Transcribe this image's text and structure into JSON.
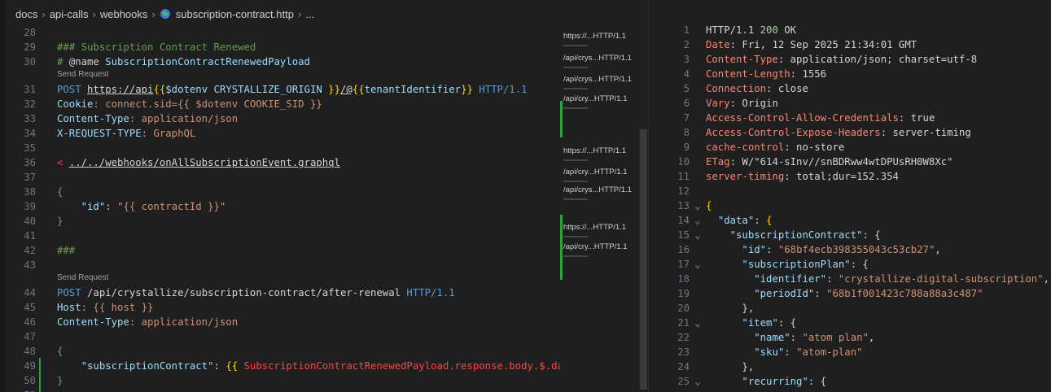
{
  "breadcrumb": [
    "docs",
    "api-calls",
    "webhooks",
    "subscription-contract.http",
    "..."
  ],
  "code_lens": [
    "Send Request",
    "Send Request"
  ],
  "editor_lines": [
    {
      "n": "28",
      "segs": []
    },
    {
      "n": "29",
      "segs": [
        {
          "t": "### Subscription Contract Renewed",
          "c": "c-comment"
        }
      ]
    },
    {
      "n": "30",
      "segs": [
        {
          "t": "# ",
          "c": "c-comment"
        },
        {
          "t": "@name ",
          "c": "c-plain"
        },
        {
          "t": "SubscriptionContractRenewedPayload",
          "c": "c-var"
        }
      ]
    },
    {
      "n": "31",
      "segs": [
        {
          "t": "POST ",
          "c": "c-method"
        },
        {
          "t": "https://api",
          "c": "c-url"
        },
        {
          "t": "{{",
          "c": "c-brace"
        },
        {
          "t": "$dotenv CRYSTALLIZE_ORIGIN ",
          "c": "c-var"
        },
        {
          "t": "}}",
          "c": "c-brace"
        },
        {
          "t": "/@",
          "c": "c-url"
        },
        {
          "t": "{{",
          "c": "c-brace"
        },
        {
          "t": "tenantIdentifier",
          "c": "c-var"
        },
        {
          "t": "}}",
          "c": "c-brace"
        },
        {
          "t": " HTTP/1.1",
          "c": "c-method"
        }
      ]
    },
    {
      "n": "32",
      "segs": [
        {
          "t": "Cookie",
          "c": "c-var"
        },
        {
          "t": ": connect.sid={{ $dotenv COOKIE_SID }}",
          "c": "c-str"
        }
      ]
    },
    {
      "n": "33",
      "segs": [
        {
          "t": "Content-Type",
          "c": "c-var"
        },
        {
          "t": ": application/json",
          "c": "c-str"
        }
      ]
    },
    {
      "n": "34",
      "segs": [
        {
          "t": "X-REQUEST-TYPE",
          "c": "c-var"
        },
        {
          "t": ": GraphQL",
          "c": "c-str"
        }
      ]
    },
    {
      "n": "35",
      "segs": []
    },
    {
      "n": "36",
      "segs": [
        {
          "t": "< ",
          "c": "c-red"
        },
        {
          "t": "../../webhooks/onAllSubscriptionEvent.graphql",
          "c": "c-url"
        }
      ]
    },
    {
      "n": "37",
      "segs": []
    },
    {
      "n": "38",
      "segs": [
        {
          "t": "{",
          "c": "c-method"
        }
      ]
    },
    {
      "n": "39",
      "segs": [
        {
          "t": "    ",
          "c": "c-plain"
        },
        {
          "t": "\"id\"",
          "c": "c-var"
        },
        {
          "t": ": ",
          "c": "c-plain"
        },
        {
          "t": "\"{{ contractId }}\"",
          "c": "c-str"
        }
      ]
    },
    {
      "n": "40",
      "segs": [
        {
          "t": "}",
          "c": "c-method"
        }
      ]
    },
    {
      "n": "41",
      "segs": []
    },
    {
      "n": "42",
      "segs": [
        {
          "t": "###",
          "c": "c-comment"
        }
      ]
    },
    {
      "n": "43",
      "segs": []
    },
    {
      "n": "44",
      "segs": [
        {
          "t": "POST ",
          "c": "c-method"
        },
        {
          "t": "/api/crystallize/subscription-contract/after-renewal",
          "c": "c-plain"
        },
        {
          "t": " HTTP/1.1",
          "c": "c-method"
        }
      ]
    },
    {
      "n": "45",
      "segs": [
        {
          "t": "Host",
          "c": "c-var"
        },
        {
          "t": ": {{ host }}",
          "c": "c-str"
        }
      ]
    },
    {
      "n": "46",
      "segs": [
        {
          "t": "Content-Type",
          "c": "c-var"
        },
        {
          "t": ": application/json",
          "c": "c-str"
        }
      ]
    },
    {
      "n": "47",
      "segs": []
    },
    {
      "n": "48",
      "segs": [
        {
          "t": "{",
          "c": "c-method"
        }
      ]
    },
    {
      "n": "49",
      "segs": [
        {
          "t": "    ",
          "c": "c-plain"
        },
        {
          "t": "\"subscriptionContract\"",
          "c": "c-var"
        },
        {
          "t": ": ",
          "c": "c-plain"
        },
        {
          "t": "{{ ",
          "c": "c-brace"
        },
        {
          "t": "SubscriptionContractRenewedPayload.response.body.$.data",
          "c": "c-red"
        }
      ]
    },
    {
      "n": "50",
      "segs": [
        {
          "t": "}",
          "c": "c-method"
        }
      ]
    },
    {
      "n": "51",
      "segs": []
    }
  ],
  "minimap_items": [
    "https://...HTTP/1.1",
    "/api/crys...HTTP/1.1",
    "/api/crys...HTTP/1.1",
    "/api/cry...HTTP/1.1",
    "https://...HTTP/1.1",
    "/api/cry...HTTP/1.1",
    "/api/crys...HTTP/1.1",
    "https://...HTTP/1.1",
    "/api/cry...HTTP/1.1"
  ],
  "response_lines": [
    {
      "n": "1",
      "fold": "",
      "segs": [
        {
          "t": "HTTP/1.1 ",
          "c": "h-proto"
        },
        {
          "t": "200",
          "c": "h-num"
        },
        {
          "t": " OK",
          "c": "h-proto"
        }
      ]
    },
    {
      "n": "2",
      "fold": "",
      "segs": [
        {
          "t": "Date",
          "c": "h-key"
        },
        {
          "t": ": Fri, 12 Sep 2025 21:34:01 GMT",
          "c": "h-proto"
        }
      ]
    },
    {
      "n": "3",
      "fold": "",
      "segs": [
        {
          "t": "Content-Type",
          "c": "h-key"
        },
        {
          "t": ": application/json; charset=utf-8",
          "c": "h-proto"
        }
      ]
    },
    {
      "n": "4",
      "fold": "",
      "segs": [
        {
          "t": "Content-Length",
          "c": "h-key"
        },
        {
          "t": ": 1556",
          "c": "h-proto"
        }
      ]
    },
    {
      "n": "5",
      "fold": "",
      "segs": [
        {
          "t": "Connection",
          "c": "h-key"
        },
        {
          "t": ": close",
          "c": "h-proto"
        }
      ]
    },
    {
      "n": "6",
      "fold": "",
      "segs": [
        {
          "t": "Vary",
          "c": "h-key"
        },
        {
          "t": ": Origin",
          "c": "h-proto"
        }
      ]
    },
    {
      "n": "7",
      "fold": "",
      "segs": [
        {
          "t": "Access-Control-Allow-Credentials",
          "c": "h-key"
        },
        {
          "t": ": true",
          "c": "h-proto"
        }
      ]
    },
    {
      "n": "8",
      "fold": "",
      "segs": [
        {
          "t": "Access-Control-Expose-Headers",
          "c": "h-key"
        },
        {
          "t": ": server-timing",
          "c": "h-proto"
        }
      ]
    },
    {
      "n": "9",
      "fold": "",
      "segs": [
        {
          "t": "cache-control",
          "c": "h-key"
        },
        {
          "t": ": no-store",
          "c": "h-proto"
        }
      ]
    },
    {
      "n": "10",
      "fold": "",
      "segs": [
        {
          "t": "ETag",
          "c": "h-key"
        },
        {
          "t": ": W/\"614-sInv//snBDRww4wtDPUsRH0W8Xc\"",
          "c": "h-proto"
        }
      ]
    },
    {
      "n": "11",
      "fold": "",
      "segs": [
        {
          "t": "server-timing",
          "c": "h-key"
        },
        {
          "t": ": total;dur=152.354",
          "c": "h-proto"
        }
      ]
    },
    {
      "n": "12",
      "fold": "",
      "segs": []
    },
    {
      "n": "13",
      "fold": "⌄",
      "segs": [
        {
          "t": "{",
          "c": "j-brace"
        }
      ]
    },
    {
      "n": "14",
      "fold": "⌄",
      "segs": [
        {
          "t": "  ",
          "c": "j-punct"
        },
        {
          "t": "\"data\"",
          "c": "j-key"
        },
        {
          "t": ": ",
          "c": "j-punct"
        },
        {
          "t": "{",
          "c": "j-brace"
        }
      ]
    },
    {
      "n": "15",
      "fold": "⌄",
      "segs": [
        {
          "t": "    ",
          "c": "j-punct"
        },
        {
          "t": "\"subscriptionContract\"",
          "c": "j-key"
        },
        {
          "t": ": {",
          "c": "j-punct"
        }
      ]
    },
    {
      "n": "16",
      "fold": "",
      "segs": [
        {
          "t": "      ",
          "c": "j-punct"
        },
        {
          "t": "\"id\"",
          "c": "j-key"
        },
        {
          "t": ": ",
          "c": "j-punct"
        },
        {
          "t": "\"68bf4ecb398355043c53cb27\"",
          "c": "j-str"
        },
        {
          "t": ",",
          "c": "j-punct"
        }
      ]
    },
    {
      "n": "17",
      "fold": "⌄",
      "segs": [
        {
          "t": "      ",
          "c": "j-punct"
        },
        {
          "t": "\"subscriptionPlan\"",
          "c": "j-key"
        },
        {
          "t": ": {",
          "c": "j-punct"
        }
      ]
    },
    {
      "n": "18",
      "fold": "",
      "segs": [
        {
          "t": "        ",
          "c": "j-punct"
        },
        {
          "t": "\"identifier\"",
          "c": "j-key"
        },
        {
          "t": ": ",
          "c": "j-punct"
        },
        {
          "t": "\"crystallize-digital-subscription\"",
          "c": "j-str"
        },
        {
          "t": ",",
          "c": "j-punct"
        }
      ]
    },
    {
      "n": "19",
      "fold": "",
      "segs": [
        {
          "t": "        ",
          "c": "j-punct"
        },
        {
          "t": "\"periodId\"",
          "c": "j-key"
        },
        {
          "t": ": ",
          "c": "j-punct"
        },
        {
          "t": "\"68b1f001423c788a88a3c487\"",
          "c": "j-str"
        }
      ]
    },
    {
      "n": "20",
      "fold": "",
      "segs": [
        {
          "t": "      },",
          "c": "j-punct"
        }
      ]
    },
    {
      "n": "21",
      "fold": "⌄",
      "segs": [
        {
          "t": "      ",
          "c": "j-punct"
        },
        {
          "t": "\"item\"",
          "c": "j-key"
        },
        {
          "t": ": {",
          "c": "j-punct"
        }
      ]
    },
    {
      "n": "22",
      "fold": "",
      "segs": [
        {
          "t": "        ",
          "c": "j-punct"
        },
        {
          "t": "\"name\"",
          "c": "j-key"
        },
        {
          "t": ": ",
          "c": "j-punct"
        },
        {
          "t": "\"atom plan\"",
          "c": "j-str"
        },
        {
          "t": ",",
          "c": "j-punct"
        }
      ]
    },
    {
      "n": "23",
      "fold": "",
      "segs": [
        {
          "t": "        ",
          "c": "j-punct"
        },
        {
          "t": "\"sku\"",
          "c": "j-key"
        },
        {
          "t": ": ",
          "c": "j-punct"
        },
        {
          "t": "\"atom-plan\"",
          "c": "j-str"
        }
      ]
    },
    {
      "n": "24",
      "fold": "",
      "segs": [
        {
          "t": "      },",
          "c": "j-punct"
        }
      ]
    },
    {
      "n": "25",
      "fold": "⌄",
      "segs": [
        {
          "t": "      ",
          "c": "j-punct"
        },
        {
          "t": "\"recurring\"",
          "c": "j-key"
        },
        {
          "t": ": {",
          "c": "j-punct"
        }
      ]
    }
  ]
}
